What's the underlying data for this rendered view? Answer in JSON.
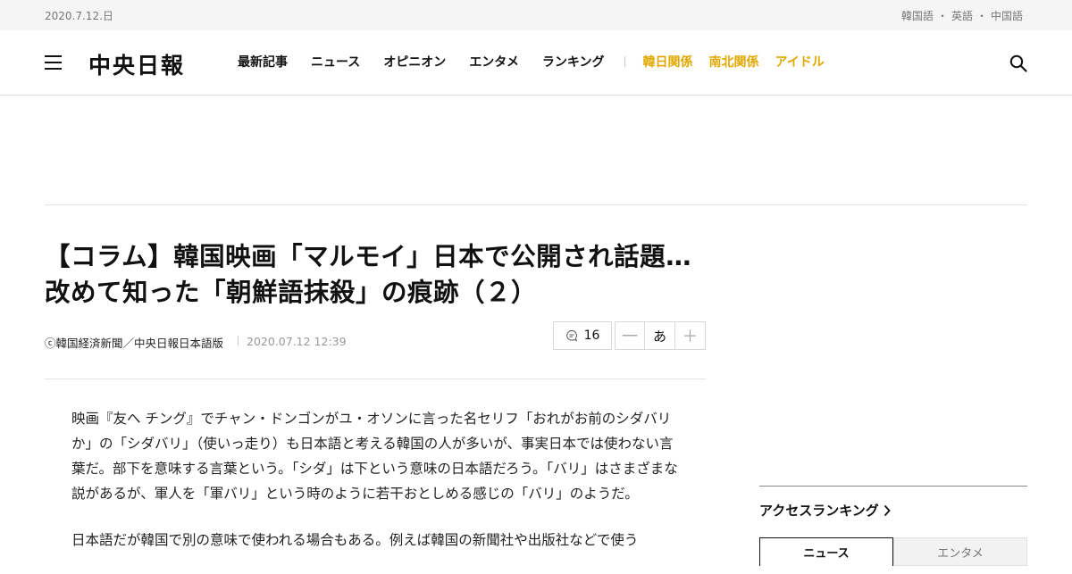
{
  "topbar": {
    "date": "2020.7.12.日",
    "languages": [
      "韓国語",
      "英語",
      "中国語"
    ],
    "separator": "・"
  },
  "header": {
    "logo": "中央日報",
    "menu": [
      "最新記事",
      "ニュース",
      "オピニオン",
      "エンタメ",
      "ランキング"
    ],
    "highlight_menu": [
      "韓日関係",
      "南北関係",
      "アイドル"
    ],
    "highlight_color": "#e0a800",
    "icons": {
      "menu": "hamburger-icon",
      "search": "search-icon"
    }
  },
  "article": {
    "headline": "【コラム】韓国映画「マルモイ」日本で公開され話題…改めて知った「朝鮮語抹殺」の痕跡（２）",
    "source": "ⓒ韓国経済新聞／中央日報日本語版",
    "timestamp": "2020.07.12 12:39",
    "comment_count": "16",
    "font_tools": {
      "minus": "一",
      "sample": "あ",
      "plus": "＋"
    },
    "paragraphs": [
      "映画『友へ チング』でチャン・ドンゴンがユ・オソンに言った名セリフ「おれがお前のシダバリか」の「シダバリ」（使いっ走り）も日本語と考える韓国の人が多いが、事実日本では使わない言葉だ。部下を意味する言葉という。「シダ」は下という意味の日本語だろう。「バリ」はさまざまな説があるが、軍人を「軍バリ」という時のように若干おとしめる感じの「バリ」のようだ。",
      "日本語だが韓国で別の意味で使われる場合もある。例えば韓国の新聞社や出版社などで使う"
    ]
  },
  "sidebar": {
    "ranking_title": "アクセスランキング",
    "tabs": [
      "ニュース",
      "エンタメ"
    ]
  }
}
